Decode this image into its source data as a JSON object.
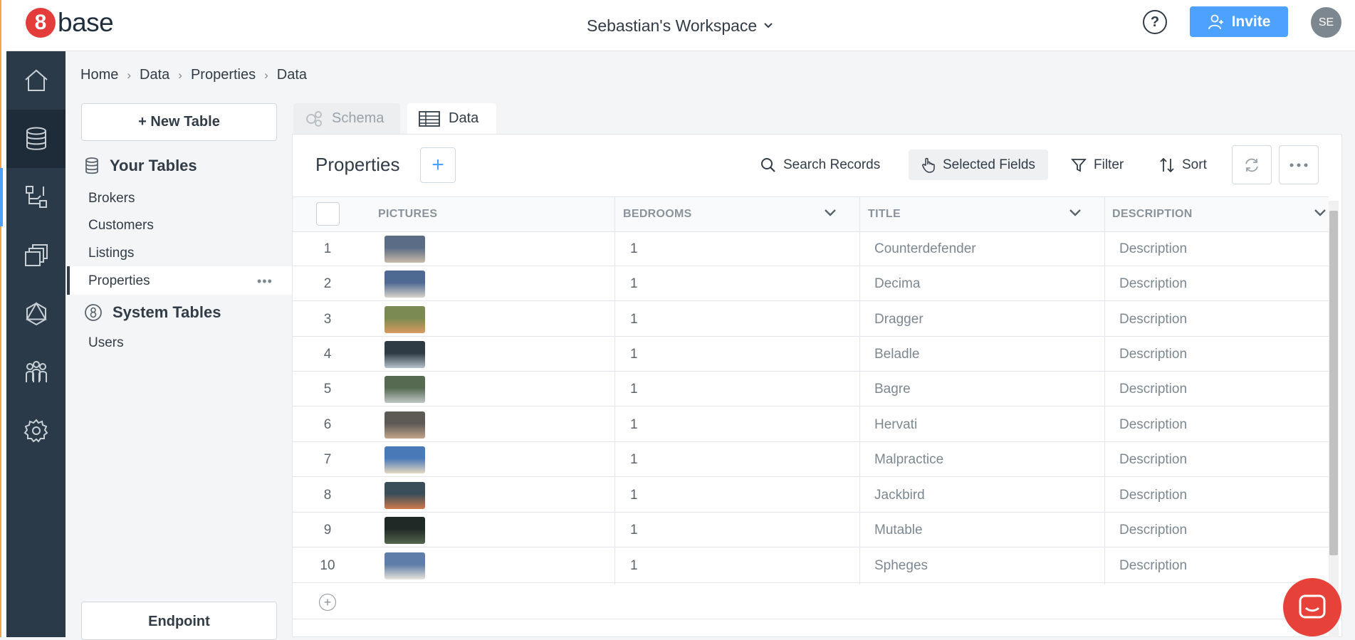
{
  "app": {
    "logo_mark": "8",
    "logo_text": "base",
    "workspace": "Sebastian's Workspace",
    "invite_label": "Invite",
    "help_label": "?",
    "avatar_initials": "SE",
    "accent": "#4da1ff",
    "brand": "#e43c3a"
  },
  "rail": {
    "items": [
      "home-icon",
      "database-icon",
      "logic-icon",
      "pages-icon",
      "graphql-icon",
      "team-icon",
      "settings-icon"
    ]
  },
  "breadcrumb": [
    "Home",
    "Data",
    "Properties",
    "Data"
  ],
  "sidebar": {
    "new_table_label": "+ New Table",
    "your_tables_label": "Your Tables",
    "your_tables": [
      "Brokers",
      "Customers",
      "Listings",
      "Properties"
    ],
    "active_table_dots": "•••",
    "system_tables_label": "System Tables",
    "system_tables": [
      "Users"
    ],
    "endpoint_label": "Endpoint"
  },
  "tabs": {
    "schema": "Schema",
    "data": "Data"
  },
  "toolbar": {
    "title": "Properties",
    "add_label": "+",
    "search": "Search Records",
    "selected_fields": "Selected Fields",
    "filter": "Filter",
    "sort": "Sort"
  },
  "table": {
    "headers": {
      "pictures": "PICTURES",
      "bedrooms": "BEDROOMS",
      "title": "TITLE",
      "description": "DESCRIPTION"
    },
    "rows": [
      {
        "n": "1",
        "bedrooms": "1",
        "title": "Counterdefender",
        "description": "Description",
        "thumb": [
          "#5b6d86",
          "#c8b9a8"
        ]
      },
      {
        "n": "2",
        "bedrooms": "1",
        "title": "Decima",
        "description": "Description",
        "thumb": [
          "#4e6a92",
          "#d8d2cc"
        ]
      },
      {
        "n": "3",
        "bedrooms": "1",
        "title": "Dragger",
        "description": "Description",
        "thumb": [
          "#7a8a52",
          "#d99a60"
        ]
      },
      {
        "n": "4",
        "bedrooms": "1",
        "title": "Beladle",
        "description": "Description",
        "thumb": [
          "#2e3a44",
          "#b7c3cc"
        ]
      },
      {
        "n": "5",
        "bedrooms": "1",
        "title": "Bagre",
        "description": "Description",
        "thumb": [
          "#566a52",
          "#bfc6c4"
        ]
      },
      {
        "n": "6",
        "bedrooms": "1",
        "title": "Hervati",
        "description": "Description",
        "thumb": [
          "#5d5a56",
          "#c2a58a"
        ]
      },
      {
        "n": "7",
        "bedrooms": "1",
        "title": "Malpractice",
        "description": "Description",
        "thumb": [
          "#4a79b8",
          "#e5d8c0"
        ]
      },
      {
        "n": "8",
        "bedrooms": "1",
        "title": "Jackbird",
        "description": "Description",
        "thumb": [
          "#3a4e5a",
          "#d07a4a"
        ]
      },
      {
        "n": "9",
        "bedrooms": "1",
        "title": "Mutable",
        "description": "Description",
        "thumb": [
          "#1f2a26",
          "#56664e"
        ]
      },
      {
        "n": "10",
        "bedrooms": "1",
        "title": "Spheges",
        "description": "Description",
        "thumb": [
          "#5e7da8",
          "#e7e3dc"
        ]
      }
    ],
    "add_row_label": "+"
  }
}
